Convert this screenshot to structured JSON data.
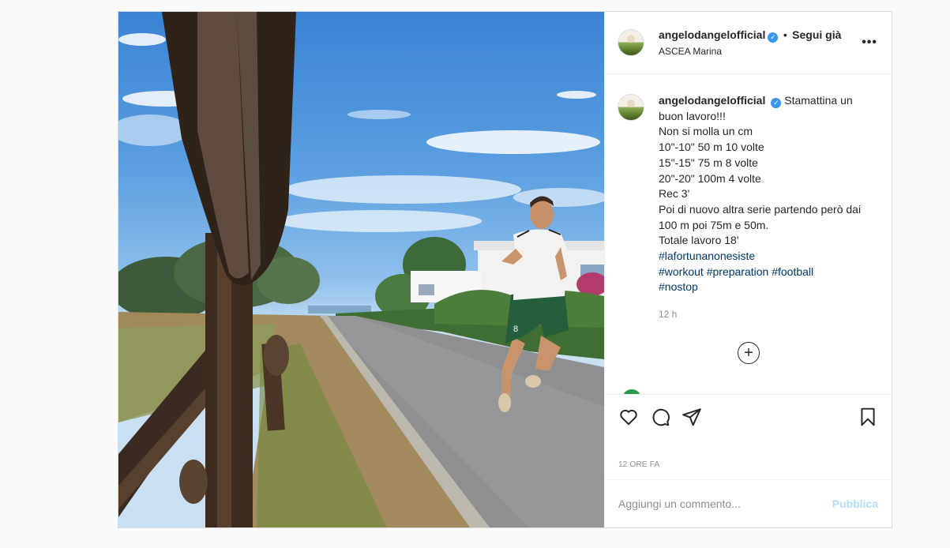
{
  "post": {
    "username": "angelodangelofficial",
    "verified_icon": "verified-badge-icon",
    "separator": "•",
    "follow_label": "Segui già",
    "location": "ASCEA Marina",
    "more_icon": "more-options-icon",
    "more_label": "•••"
  },
  "caption": {
    "username": "angelodangelofficial",
    "lines": [
      "Stamattina un buon lavoro!!!",
      "Non si molla un cm",
      "10\"-10\" 50 m 10 volte",
      "15\"-15\" 75 m 8 volte",
      "20\"-20\" 100m 4 volte",
      "Rec 3'",
      "Poi di nuovo altra serie partendo però dai 100 m poi 75m e 50m.",
      "Totale lavoro 18'"
    ],
    "hashtags": [
      "#lafortunanonesiste",
      "#workout",
      "#preparation",
      "#football",
      "#nostop"
    ],
    "time": "12 h"
  },
  "load_more": {
    "icon": "plus-circle-icon",
    "label": "+"
  },
  "actions": {
    "like_icon": "heart-icon",
    "comment_icon": "comment-icon",
    "share_icon": "paper-plane-icon",
    "save_icon": "bookmark-icon"
  },
  "post_time": "12 ORE FA",
  "comment_box": {
    "placeholder": "Aggiungi un commento...",
    "publish_label": "Pubblica"
  },
  "colors": {
    "link": "#00376b",
    "verified": "#3897f0",
    "muted": "#8e8e8e",
    "publish_disabled": "#b2dffc",
    "border": "#dbdbdb"
  }
}
